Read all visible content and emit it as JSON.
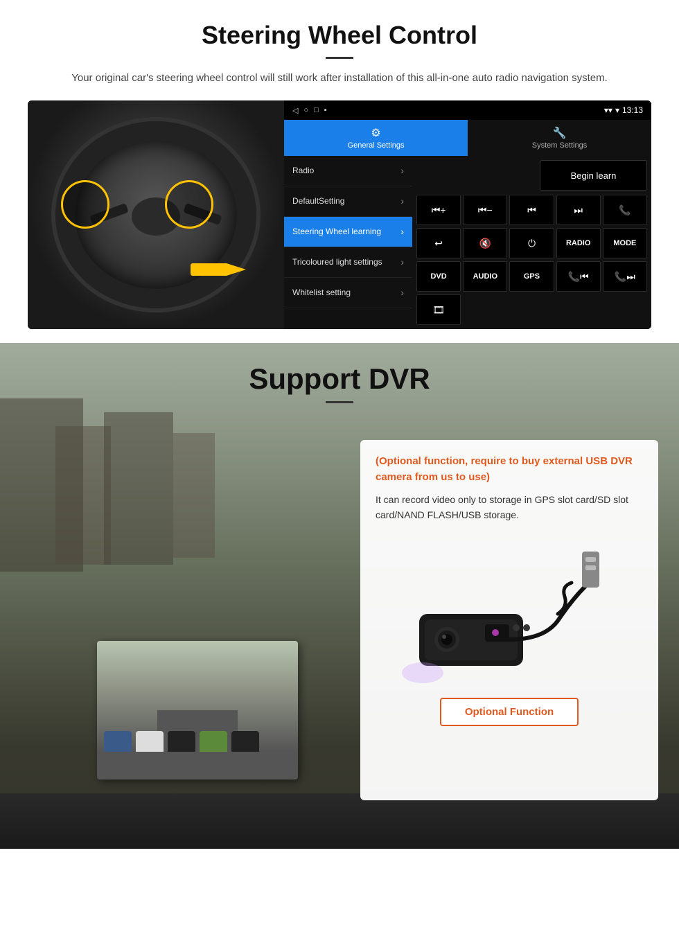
{
  "page": {
    "steering_section": {
      "title": "Steering Wheel Control",
      "subtitle": "Your original car's steering wheel control will still work after installation of this all-in-one auto radio navigation system."
    },
    "android_ui": {
      "status_bar": {
        "time": "13:13",
        "icons_left": [
          "◁",
          "○",
          "□",
          "▪"
        ],
        "icons_right": [
          "signal",
          "wifi",
          "battery"
        ]
      },
      "tabs": [
        {
          "id": "general",
          "label": "General Settings",
          "active": true
        },
        {
          "id": "system",
          "label": "System Settings",
          "active": false
        }
      ],
      "menu_items": [
        {
          "label": "Radio",
          "active": false
        },
        {
          "label": "DefaultSetting",
          "active": false
        },
        {
          "label": "Steering Wheel learning",
          "active": true
        },
        {
          "label": "Tricoloured light settings",
          "active": false
        },
        {
          "label": "Whitelist setting",
          "active": false
        }
      ],
      "begin_learn_label": "Begin learn",
      "control_buttons": [
        {
          "row": 1,
          "buttons": [
            "⏮+",
            "⏮−",
            "⏮",
            "⏭",
            "📞"
          ]
        },
        {
          "row": 2,
          "buttons": [
            "↩",
            "🔇",
            "⏻",
            "RADIO",
            "MODE"
          ]
        },
        {
          "row": 3,
          "buttons": [
            "DVD",
            "AUDIO",
            "GPS",
            "📞⏮",
            "📞⏭"
          ]
        },
        {
          "row": 4,
          "buttons": [
            "📋"
          ]
        }
      ]
    },
    "dvr_section": {
      "title": "Support DVR",
      "optional_text": "(Optional function, require to buy external USB DVR camera from us to use)",
      "description": "It can record video only to storage in GPS slot card/SD slot card/NAND FLASH/USB storage.",
      "optional_function_label": "Optional Function"
    }
  }
}
